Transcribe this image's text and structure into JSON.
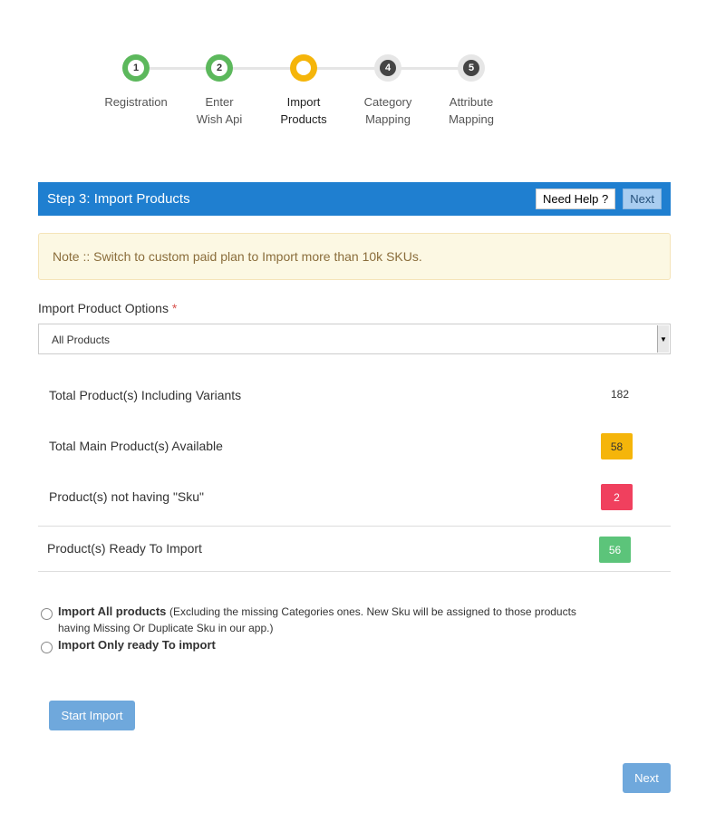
{
  "steps": [
    {
      "number": "1",
      "label": "Registration",
      "state": "done"
    },
    {
      "number": "2",
      "label": "Enter Wish Api",
      "state": "done"
    },
    {
      "number": "",
      "label": "Import Products",
      "state": "active"
    },
    {
      "number": "4",
      "label": "Category Mapping",
      "state": "todo"
    },
    {
      "number": "5",
      "label": "Attribute Mapping",
      "state": "todo"
    }
  ],
  "header": {
    "title": "Step 3: Import Products",
    "help_label": "Need Help ?",
    "next_label": "Next"
  },
  "note": "Note :: Switch to custom paid plan to Import more than 10k SKUs.",
  "import_options": {
    "label": "Import Product Options",
    "required_mark": "*",
    "selected": "All Products"
  },
  "stats": {
    "total_including_variants": {
      "label": "Total Product(s) Including Variants",
      "value": "182"
    },
    "total_main": {
      "label": "Total Main Product(s) Available",
      "value": "58",
      "color": "#f5b50a"
    },
    "not_having_sku": {
      "label": "Product(s) not having \"Sku\"",
      "value": "2",
      "color": "#f0405e"
    },
    "ready_to_import": {
      "label": "Product(s) Ready To Import",
      "value": "56",
      "color": "#5cc47a"
    }
  },
  "radios": {
    "import_all": {
      "title": "Import All products",
      "desc": "(Excluding the missing Categories ones. New Sku will be assigned to those products having Missing Or Duplicate Sku in our app.)"
    },
    "import_ready": {
      "title": "Import Only ready To import"
    }
  },
  "buttons": {
    "start_import": "Start Import",
    "next": "Next"
  },
  "colors": {
    "header_bg": "#1f7fd0",
    "step_done": "#5cb85c",
    "step_active": "#f5b50a",
    "button_bg": "#6fa8dc"
  }
}
